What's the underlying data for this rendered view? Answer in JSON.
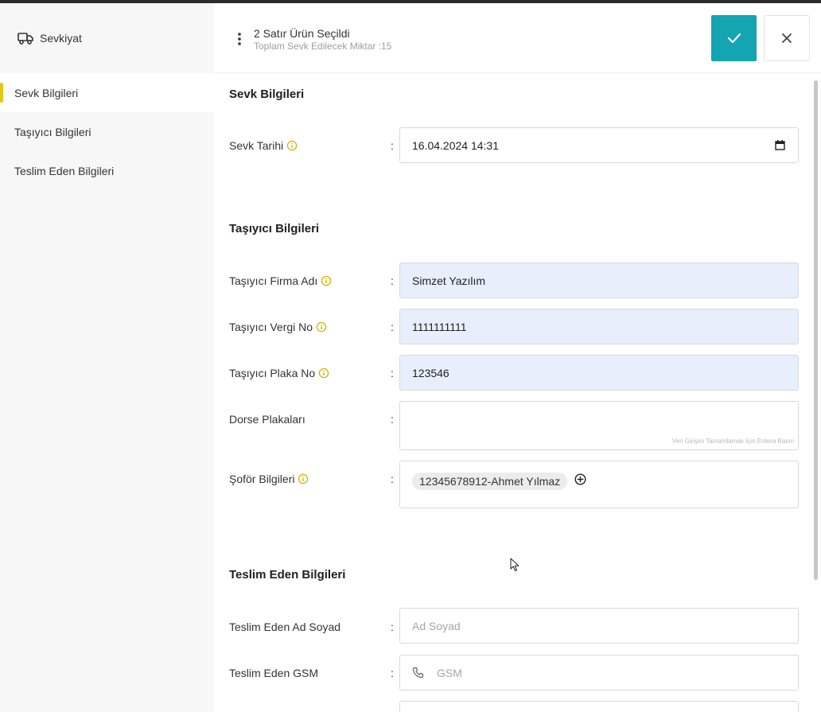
{
  "sidebar": {
    "title": "Sevkiyat",
    "items": [
      {
        "label": "Sevk Bilgileri"
      },
      {
        "label": "Taşıyıcı Bilgileri"
      },
      {
        "label": "Teslim Eden Bilgileri"
      }
    ]
  },
  "header": {
    "title": "2 Satır Ürün Seçildi",
    "subtitle": "Toplam Sevk Edilecek Miktar :15"
  },
  "sections": {
    "sevk": {
      "title": "Sevk Bilgileri",
      "tarih_label": "Sevk Tarihi",
      "tarih_value": "16.04.2024 14:31"
    },
    "tasiyici": {
      "title": "Taşıyıcı Bilgileri",
      "firma_label": "Taşıyıcı Firma Adı",
      "firma_value": "Simzet Yazılım",
      "vergi_label": "Taşıyıcı Vergi No",
      "vergi_value": "1111111111",
      "plaka_label": "Taşıyıcı Plaka No",
      "plaka_value": "123546",
      "dorse_label": "Dorse Plakaları",
      "dorse_hint": "Veri Girişini Tamamlamak İçin Entera Basın",
      "sofor_label": "Şoför Bilgileri",
      "sofor_chip": "12345678912-Ahmet Yılmaz"
    },
    "teslim": {
      "title": "Teslim Eden Bilgileri",
      "ad_label": "Teslim Eden Ad Soyad",
      "ad_placeholder": "Ad Soyad",
      "gsm_label": "Teslim Eden GSM",
      "gsm_placeholder": "GSM"
    }
  },
  "colon": ":",
  "colors": {
    "accent": "#14a4b2",
    "active_marker": "#e6c619",
    "filled_field": "#e8eefc",
    "info_icon": "#d4b400"
  }
}
